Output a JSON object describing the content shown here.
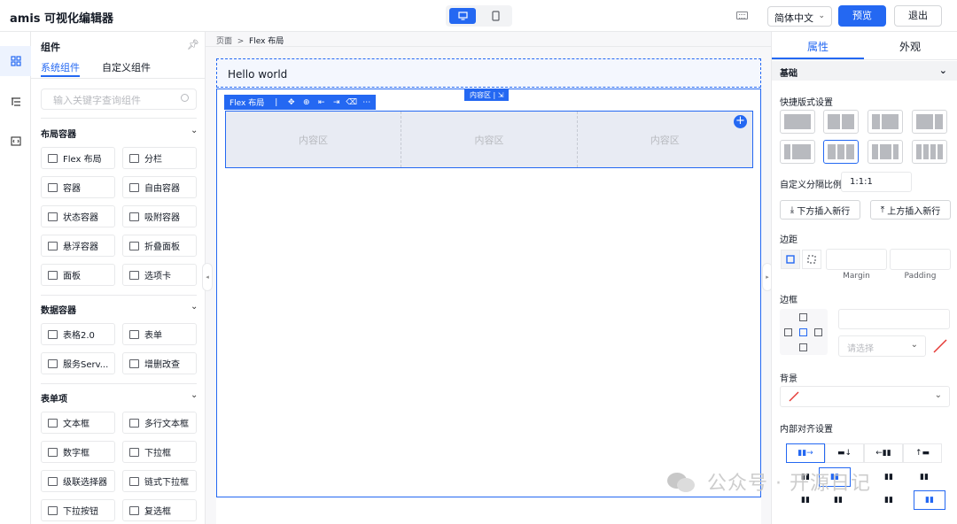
{
  "app": {
    "title": "amis 可视化编辑器"
  },
  "header": {
    "lang": "简体中文",
    "preview": "预览",
    "exit": "退出"
  },
  "left_panel": {
    "title": "组件",
    "tabs": [
      "系统组件",
      "自定义组件"
    ],
    "search_placeholder": "输入关键字查询组件",
    "groups": [
      {
        "title": "布局容器",
        "items": [
          "Flex 布局",
          "分栏",
          "容器",
          "自由容器",
          "状态容器",
          "吸附容器",
          "悬浮容器",
          "折叠面板",
          "面板",
          "选项卡"
        ]
      },
      {
        "title": "数据容器",
        "items": [
          "表格2.0",
          "表单",
          "服务Serv...",
          "增删改查"
        ]
      },
      {
        "title": "表单项",
        "items": [
          "文本框",
          "多行文本框",
          "数字框",
          "下拉框",
          "级联选择器",
          "链式下拉框",
          "下拉按钮",
          "复选框"
        ]
      }
    ]
  },
  "canvas": {
    "breadcrumb": [
      "页面",
      "Flex 布局"
    ],
    "hello": "Hello world",
    "flex_toolbar_label": "Flex 布局",
    "inner_tag": "内容区",
    "cells": [
      "内容区",
      "内容区",
      "内容区"
    ]
  },
  "right_panel": {
    "tabs": [
      "属性",
      "外观"
    ],
    "section_basic": "基础",
    "quick_layout": "快捷版式设置",
    "custom_ratio": "自定义分隔比例",
    "ratio_value": "1:1:1",
    "insert_below": "下方插入新行",
    "insert_above": "上方插入新行",
    "margin_title": "边距",
    "margin": "Margin",
    "padding": "Padding",
    "border_title": "边框",
    "select_placeholder": "请选择",
    "background_title": "背景",
    "align_title": "内部对齐设置"
  },
  "watermark": "公众号 · 开源日记",
  "colors": {
    "primary": "#2468f2",
    "border": "#e8e9eb"
  }
}
